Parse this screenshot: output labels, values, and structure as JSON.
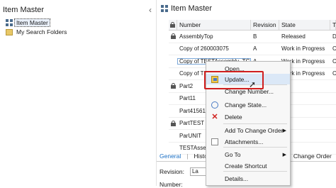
{
  "left_pane": {
    "title": "Item Master",
    "collapse_glyph": "‹",
    "tree": [
      {
        "label": "Item Master",
        "icon": "grid-icon"
      },
      {
        "label": "My Search Folders",
        "icon": "folder-icon"
      }
    ]
  },
  "right_pane": {
    "title": "Item Master",
    "table": {
      "headers": [
        "Number",
        "Revision",
        "State",
        "T"
      ],
      "rows": [
        {
          "locked": true,
          "number": "AssemblyTop",
          "revision": "B",
          "state": "Released",
          "t": "D"
        },
        {
          "locked": false,
          "number": "Copy of 260003075",
          "revision": "A",
          "state": "Work in Progress",
          "t": "Ce"
        },
        {
          "locked": false,
          "number": "Copy of TESTAssembly_TC",
          "revision": "A",
          "state": "Work in Progress",
          "t": "Ce"
        },
        {
          "locked": false,
          "number": "Copy of TEST",
          "revision": "",
          "state": "Work in Progress",
          "t": "Ce"
        },
        {
          "locked": true,
          "number": "Part2",
          "revision": "",
          "state": "",
          "t": ""
        },
        {
          "locked": false,
          "number": "Part11",
          "revision": "",
          "state": "",
          "t": ""
        },
        {
          "locked": false,
          "number": "Part415615",
          "revision": "",
          "state": "",
          "t": ""
        },
        {
          "locked": true,
          "number": "PartTEST",
          "revision": "",
          "state": "",
          "t": ""
        },
        {
          "locked": false,
          "number": "ParUNIT",
          "revision": "",
          "state": "",
          "t": ""
        },
        {
          "locked": false,
          "number": "TESTAssem",
          "revision": "",
          "state": "",
          "t": ""
        }
      ]
    },
    "bottom_tabs": [
      "General",
      "History",
      "Change Order"
    ],
    "revision_label": "Revision:",
    "revision_value": "La",
    "number_label": "Number:"
  },
  "context_menu": {
    "items": [
      {
        "label": "Open...",
        "icon": "",
        "submenu": false,
        "highlighted": false
      },
      {
        "label": "Update...",
        "icon": "update-icon",
        "submenu": false,
        "highlighted": true
      },
      {
        "label": "Change Number...",
        "icon": "",
        "submenu": false,
        "highlighted": false
      },
      {
        "label": "Change State...",
        "icon": "change-state-icon",
        "submenu": false,
        "highlighted": false
      },
      {
        "label": "Delete",
        "icon": "delete-icon",
        "submenu": false,
        "highlighted": false
      },
      {
        "label": "Add To Change Order",
        "icon": "",
        "submenu": true,
        "highlighted": false
      },
      {
        "label": "Attachments...",
        "icon": "attachment-icon",
        "submenu": false,
        "highlighted": false
      },
      {
        "label": "Go To",
        "icon": "",
        "submenu": true,
        "highlighted": false
      },
      {
        "label": "Create Shortcut",
        "icon": "",
        "submenu": false,
        "highlighted": false
      },
      {
        "label": "Details...",
        "icon": "",
        "submenu": false,
        "highlighted": false
      }
    ],
    "highlight_color": "#d01f1f",
    "submenu_glyph": "▶",
    "delete_glyph": "✕"
  }
}
